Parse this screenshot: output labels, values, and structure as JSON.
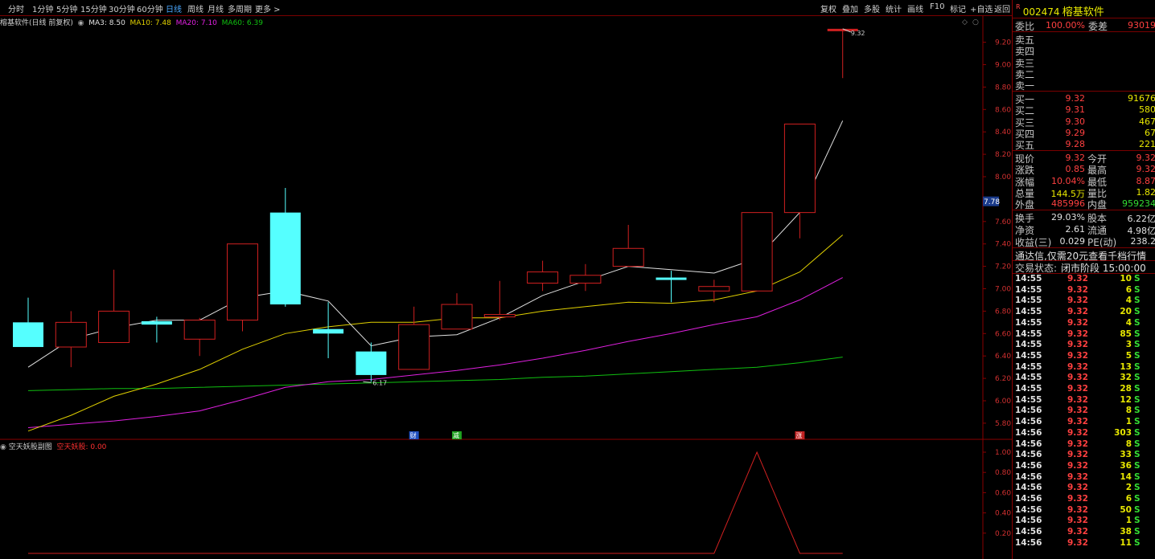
{
  "toolbar": {
    "periods": [
      "分时",
      "1分钟",
      "5分钟",
      "15分钟",
      "30分钟",
      "60分钟",
      "日线",
      "周线",
      "月线",
      "多周期",
      "更多 >"
    ],
    "active_period": "日线",
    "tools": [
      "复权",
      "叠加",
      "多股",
      "统计",
      "画线",
      "F10",
      "标记",
      "+自选",
      "返回"
    ]
  },
  "info": {
    "title": "榕基软件(日线 前复权)",
    "ma3": "MA3: 8.50",
    "ma10": "MA10: 7.48",
    "ma20": "MA20: 7.10",
    "ma60": "MA60: 6.39"
  },
  "subchart": {
    "title": "空天妖股副图",
    "indicator": "空天妖股: 0.00"
  },
  "colors": {
    "up": "#d02020",
    "down": "#55ffff",
    "ma3": "#e0e0e0",
    "ma10": "#e0d000",
    "ma20": "#e020e0",
    "ma60": "#10c010",
    "border": "#8a0000"
  },
  "chart_data": {
    "type": "candlestick",
    "candles": [
      {
        "o": 6.7,
        "c": 6.48,
        "h": 6.92,
        "l": 6.48
      },
      {
        "o": 6.48,
        "c": 6.7,
        "h": 6.8,
        "l": 6.3
      },
      {
        "o": 6.52,
        "c": 6.8,
        "h": 7.17,
        "l": 6.52
      },
      {
        "o": 6.71,
        "c": 6.68,
        "h": 6.75,
        "l": 6.52
      },
      {
        "o": 6.55,
        "c": 6.72,
        "h": 6.74,
        "l": 6.4
      },
      {
        "o": 6.72,
        "c": 7.4,
        "h": 7.4,
        "l": 6.62
      },
      {
        "o": 7.68,
        "c": 6.86,
        "h": 7.9,
        "l": 6.84
      },
      {
        "o": 6.64,
        "c": 6.6,
        "h": 6.88,
        "l": 6.38
      },
      {
        "o": 6.44,
        "c": 6.23,
        "h": 6.52,
        "l": 6.17
      },
      {
        "o": 6.28,
        "c": 6.68,
        "h": 6.84,
        "l": 6.28
      },
      {
        "o": 6.64,
        "c": 6.86,
        "h": 6.96,
        "l": 6.64
      },
      {
        "o": 6.75,
        "c": 6.77,
        "h": 7.07,
        "l": 6.72
      },
      {
        "o": 7.05,
        "c": 7.15,
        "h": 7.25,
        "l": 6.98
      },
      {
        "o": 7.05,
        "c": 7.12,
        "h": 7.22,
        "l": 6.98
      },
      {
        "o": 7.2,
        "c": 7.36,
        "h": 7.57,
        "l": 7.2
      },
      {
        "o": 7.1,
        "c": 7.08,
        "h": 7.16,
        "l": 6.88
      },
      {
        "o": 6.98,
        "c": 7.02,
        "h": 7.08,
        "l": 6.88
      },
      {
        "o": 6.98,
        "c": 7.68,
        "h": 7.68,
        "l": 6.98
      },
      {
        "o": 7.68,
        "c": 8.47,
        "h": 8.47,
        "l": 7.45
      },
      {
        "o": 9.32,
        "c": 9.32,
        "h": 9.32,
        "l": 8.88
      }
    ],
    "ma3": [
      6.3,
      6.55,
      6.65,
      6.72,
      6.72,
      6.92,
      6.98,
      6.89,
      6.49,
      6.57,
      6.59,
      6.74,
      6.94,
      7.07,
      7.2,
      7.17,
      7.14,
      7.27,
      7.68,
      8.5
    ],
    "ma10": [
      5.73,
      5.87,
      6.04,
      6.15,
      6.28,
      6.46,
      6.6,
      6.66,
      6.7,
      6.7,
      6.74,
      6.74,
      6.8,
      6.84,
      6.88,
      6.87,
      6.9,
      6.98,
      7.15,
      7.48
    ],
    "ma20": [
      5.76,
      5.79,
      5.82,
      5.86,
      5.91,
      6.01,
      6.12,
      6.17,
      6.19,
      6.23,
      6.27,
      6.32,
      6.38,
      6.45,
      6.53,
      6.6,
      6.68,
      6.75,
      6.9,
      7.1
    ],
    "ma60": [
      6.09,
      6.1,
      6.11,
      6.11,
      6.12,
      6.13,
      6.14,
      6.15,
      6.16,
      6.17,
      6.18,
      6.19,
      6.21,
      6.22,
      6.24,
      6.26,
      6.28,
      6.3,
      6.34,
      6.39
    ],
    "y_ticks": [
      "9.20",
      "9.00",
      "8.80",
      "8.60",
      "8.40",
      "8.20",
      "8.00",
      "7.60",
      "7.40",
      "7.20",
      "7.00",
      "6.80",
      "6.60",
      "6.40",
      "6.20",
      "6.00",
      "5.80"
    ],
    "ylim": [
      5.75,
      9.4
    ],
    "price_tag": "7.78",
    "high_label": "9.32",
    "low_label": "6.17",
    "markers": [
      "财",
      "减",
      "涨"
    ],
    "sub_y_ticks": [
      "1.00",
      "0.80",
      "0.60",
      "0.40",
      "0.20"
    ],
    "sub_values": [
      0,
      0,
      0,
      0,
      0,
      0,
      0,
      0,
      0,
      0,
      0,
      0,
      0,
      0,
      0,
      0,
      0,
      1,
      0,
      0
    ]
  },
  "quote": {
    "flag": "R",
    "code": "002474",
    "name": "榕基软件",
    "weibi_label": "委比",
    "weibi": "100.00%",
    "weicha_label": "委差",
    "weicha": "93019",
    "sell": [
      "卖五",
      "卖四",
      "卖三",
      "卖二",
      "卖一"
    ],
    "buy": [
      {
        "label": "买一",
        "price": "9.32",
        "vol": "91676"
      },
      {
        "label": "买二",
        "price": "9.31",
        "vol": "580"
      },
      {
        "label": "买三",
        "price": "9.30",
        "vol": "467"
      },
      {
        "label": "买四",
        "price": "9.29",
        "vol": "67"
      },
      {
        "label": "买五",
        "price": "9.28",
        "vol": "221"
      }
    ],
    "stats_left": [
      {
        "label": "现价",
        "value": "9.32",
        "cls": "red"
      },
      {
        "label": "涨跌",
        "value": "0.85",
        "cls": "red"
      },
      {
        "label": "涨幅",
        "value": "10.04%",
        "cls": "red"
      },
      {
        "label": "总量",
        "value": "144.5万",
        "cls": "yellow"
      },
      {
        "label": "外盘",
        "value": "485996",
        "cls": "red"
      }
    ],
    "stats_right": [
      {
        "label": "今开",
        "value": "9.32",
        "cls": "red"
      },
      {
        "label": "最高",
        "value": "9.32",
        "cls": "red"
      },
      {
        "label": "最低",
        "value": "8.87",
        "cls": "red"
      },
      {
        "label": "量比",
        "value": "1.82",
        "cls": "yellow"
      },
      {
        "label": "内盘",
        "value": "959234",
        "cls": "green"
      }
    ],
    "fin_left": [
      {
        "label": "换手",
        "value": "29.03%"
      },
      {
        "label": "净资",
        "value": "2.61"
      },
      {
        "label": "收益(三)",
        "value": "0.029"
      }
    ],
    "fin_right": [
      {
        "label": "股本",
        "value": "6.22亿"
      },
      {
        "label": "流通",
        "value": "4.98亿"
      },
      {
        "label": "PE(动)",
        "value": "238.2"
      }
    ],
    "notice": "通达信,仅需20元查看千档行情",
    "trade_status_label": "交易状态:",
    "trade_status": "闭市阶段 15:00:00"
  },
  "ticks": [
    {
      "t": "14:55",
      "p": "9.32",
      "v": "10",
      "d": "S"
    },
    {
      "t": "14:55",
      "p": "9.32",
      "v": "6",
      "d": "S"
    },
    {
      "t": "14:55",
      "p": "9.32",
      "v": "4",
      "d": "S"
    },
    {
      "t": "14:55",
      "p": "9.32",
      "v": "20",
      "d": "S"
    },
    {
      "t": "14:55",
      "p": "9.32",
      "v": "4",
      "d": "S"
    },
    {
      "t": "14:55",
      "p": "9.32",
      "v": "85",
      "d": "S"
    },
    {
      "t": "14:55",
      "p": "9.32",
      "v": "3",
      "d": "S"
    },
    {
      "t": "14:55",
      "p": "9.32",
      "v": "5",
      "d": "S"
    },
    {
      "t": "14:55",
      "p": "9.32",
      "v": "13",
      "d": "S"
    },
    {
      "t": "14:55",
      "p": "9.32",
      "v": "32",
      "d": "S"
    },
    {
      "t": "14:55",
      "p": "9.32",
      "v": "28",
      "d": "S"
    },
    {
      "t": "14:55",
      "p": "9.32",
      "v": "12",
      "d": "S"
    },
    {
      "t": "14:56",
      "p": "9.32",
      "v": "8",
      "d": "S"
    },
    {
      "t": "14:56",
      "p": "9.32",
      "v": "1",
      "d": "S"
    },
    {
      "t": "14:56",
      "p": "9.32",
      "v": "303",
      "d": "S"
    },
    {
      "t": "14:56",
      "p": "9.32",
      "v": "8",
      "d": "S"
    },
    {
      "t": "14:56",
      "p": "9.32",
      "v": "33",
      "d": "S"
    },
    {
      "t": "14:56",
      "p": "9.32",
      "v": "36",
      "d": "S"
    },
    {
      "t": "14:56",
      "p": "9.32",
      "v": "14",
      "d": "S"
    },
    {
      "t": "14:56",
      "p": "9.32",
      "v": "2",
      "d": "S"
    },
    {
      "t": "14:56",
      "p": "9.32",
      "v": "6",
      "d": "S"
    },
    {
      "t": "14:56",
      "p": "9.32",
      "v": "50",
      "d": "S"
    },
    {
      "t": "14:56",
      "p": "9.32",
      "v": "1",
      "d": "S"
    },
    {
      "t": "14:56",
      "p": "9.32",
      "v": "38",
      "d": "S"
    },
    {
      "t": "14:56",
      "p": "9.32",
      "v": "11",
      "d": "S"
    }
  ]
}
